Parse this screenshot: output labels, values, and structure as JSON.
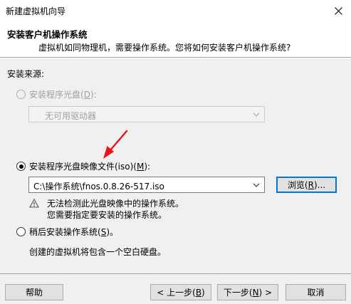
{
  "window": {
    "title": "新建虚拟机向导"
  },
  "header": {
    "title": "安装客户机操作系统",
    "subtitle": "虚拟机如同物理机，需要操作系统。您将如何安装客户机操作系统?"
  },
  "install_source": {
    "label": "安装来源:",
    "disc": {
      "prefix": "安装程序光盘(",
      "key": "D",
      "suffix": "):",
      "selected": false,
      "enabled": false,
      "drive_value": "无可用驱动器"
    },
    "iso": {
      "prefix": "安装程序光盘映像文件(iso)(",
      "key": "M",
      "suffix": "):",
      "selected": true,
      "path_value": "C:\\操作系统\\fnos.0.8.26-517.iso",
      "browse_prefix": "浏览(",
      "browse_key": "R",
      "browse_suffix": ")...",
      "warning_line1": "无法检测此光盘映像中的操作系统。",
      "warning_line2": "您需要指定要安装的操作系统。"
    },
    "later": {
      "prefix": "稍后安装操作系统(",
      "key": "S",
      "suffix": ")。",
      "selected": false,
      "description": "创建的虚拟机将包含一个空白硬盘。"
    }
  },
  "footer": {
    "help": "帮助",
    "back_prefix": "< 上一步(",
    "back_key": "B",
    "back_suffix": ")",
    "next_prefix": "下一步(",
    "next_key": "N",
    "next_suffix": ") >",
    "cancel": "取消"
  },
  "colors": {
    "annotation_arrow": "#e8141a",
    "default_button_border": "#0078d7"
  }
}
